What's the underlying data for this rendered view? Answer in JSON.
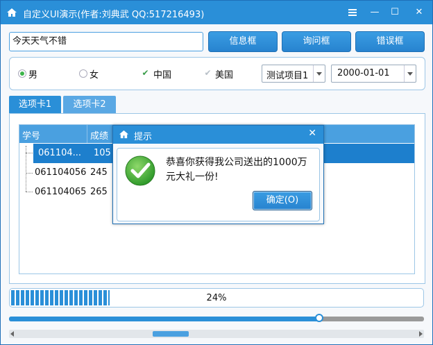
{
  "window": {
    "title": "自定义UI演示(作者:刘典武 QQ:517216493)",
    "accent_color": "#2a8fd8",
    "controls": {
      "menu_icon": "hamburger-icon",
      "minimize_label": "—",
      "maximize_label": "☐",
      "close_label": "✕"
    }
  },
  "toolbar": {
    "text_value": "今天天气不错",
    "info_button": "信息框",
    "question_button": "询问框",
    "error_button": "错误框"
  },
  "options": {
    "radio_male": "男",
    "radio_female": "女",
    "male_selected": true,
    "check_china": "中国",
    "check_usa": "美国",
    "combo_project": "测试项目1",
    "date_value": "2000-01-01"
  },
  "tabs": [
    {
      "label": "选项卡1",
      "active": true
    },
    {
      "label": "选项卡2",
      "active": false
    }
  ],
  "tree": {
    "headers": [
      "学号",
      "成绩"
    ],
    "rows": [
      {
        "id": "061104...",
        "score": "105",
        "selected": true
      },
      {
        "id": "061104056",
        "score": "245",
        "selected": false
      },
      {
        "id": "061104065",
        "score": "265",
        "selected": false
      }
    ]
  },
  "dialog": {
    "title": "提示",
    "close_glyph": "✕",
    "message": "恭喜你获得我公司送出的1000万元大礼一份!",
    "ok_button": "确定(O)",
    "icon": "success-check-icon"
  },
  "progress": {
    "value": 0.24,
    "label": "24%"
  },
  "slider": {
    "value": 0.747
  },
  "scrollbar": {
    "thumb_start": 0.34,
    "thumb_size": 0.09
  }
}
